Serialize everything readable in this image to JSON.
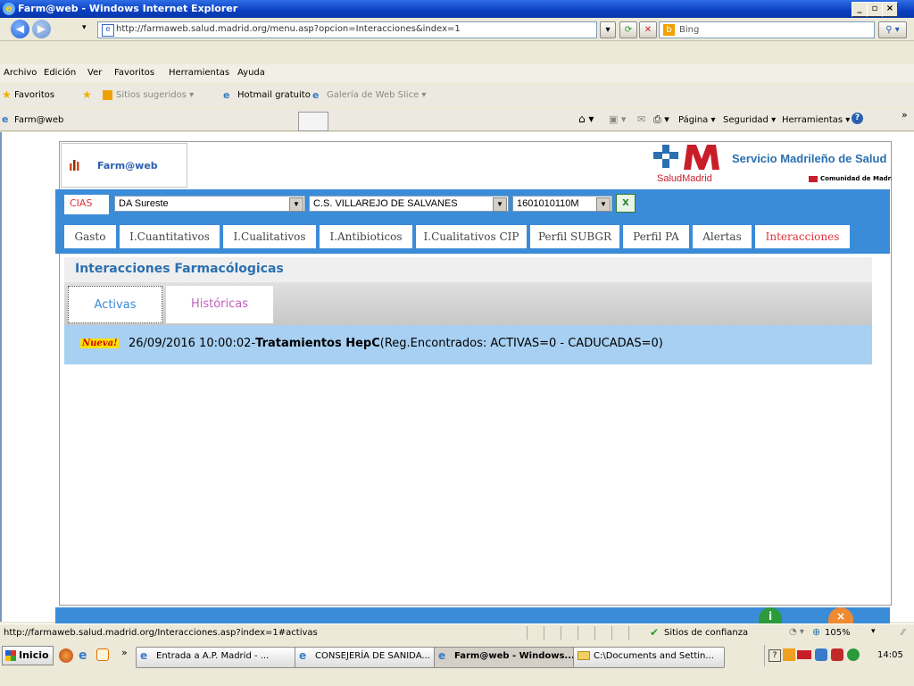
{
  "window": {
    "title": "Farm@web - Windows Internet Explorer"
  },
  "address": {
    "url": "http://farmaweb.salud.madrid.org/menu.asp?opcion=Interacciones&index=1"
  },
  "search": {
    "engine": "Bing"
  },
  "menu": [
    "Archivo",
    "Edición",
    "Ver",
    "Favoritos",
    "Herramientas",
    "Ayuda"
  ],
  "favorites": {
    "label": "Favoritos",
    "items": [
      "Sitios sugeridos ▾",
      "Hotmail gratuito",
      "Galería de Web Slice ▾"
    ]
  },
  "tab": {
    "title": "Farm@web"
  },
  "command_bar": {
    "pagina": "Página ▾",
    "seguridad": "Seguridad ▾",
    "herramientas": "Herramientas ▾"
  },
  "app": {
    "logo_text": "Farm@web",
    "brand": "Servicio Madrileño de Salud",
    "brand_sub": "SaludMadrid",
    "comunidad": "Comunidad de Madrid",
    "cias_label": "CIAS",
    "area_value": "DA Sureste",
    "centro_value": "C.S. VILLAREJO DE SALVANES",
    "cias_value": "1601010110M",
    "nav_tabs": [
      "Gasto",
      "I.Cuantitativos",
      "I.Cualitativos",
      "I.Antibioticos",
      "I.Cualitativos CIP",
      "Perfil SUBGR",
      "Perfil PA",
      "Alertas",
      "Interacciones"
    ],
    "section_title": "Interacciones Farmacólogicas",
    "subtabs": [
      "Activas",
      "Históricas"
    ],
    "info": {
      "badge": "Nueva!",
      "date": "26/09/2016 10:00:02-",
      "title": "Tratamientos HepC",
      "details": "(Reg.Encontrados: ACTIVAS=0 - CADUCADAS=0)"
    }
  },
  "status": {
    "url": "http://farmaweb.salud.madrid.org/Interacciones.asp?index=1#activas",
    "zone": "Sitios de confianza",
    "zoom": "105%"
  },
  "taskbar": {
    "start": "Inicio",
    "tasks": [
      "Entrada a A.P. Madrid - ...",
      "CONSEJERÍA DE SANIDA...",
      "Farm@web - Windows...",
      "C:\\Documents and Settin..."
    ],
    "time": "14:05"
  },
  "colors": {
    "accent": "#3b8cd8",
    "active_tab": "#e0303a",
    "section_title": "#2a6fb0",
    "info_bg": "#a7d0f2"
  }
}
